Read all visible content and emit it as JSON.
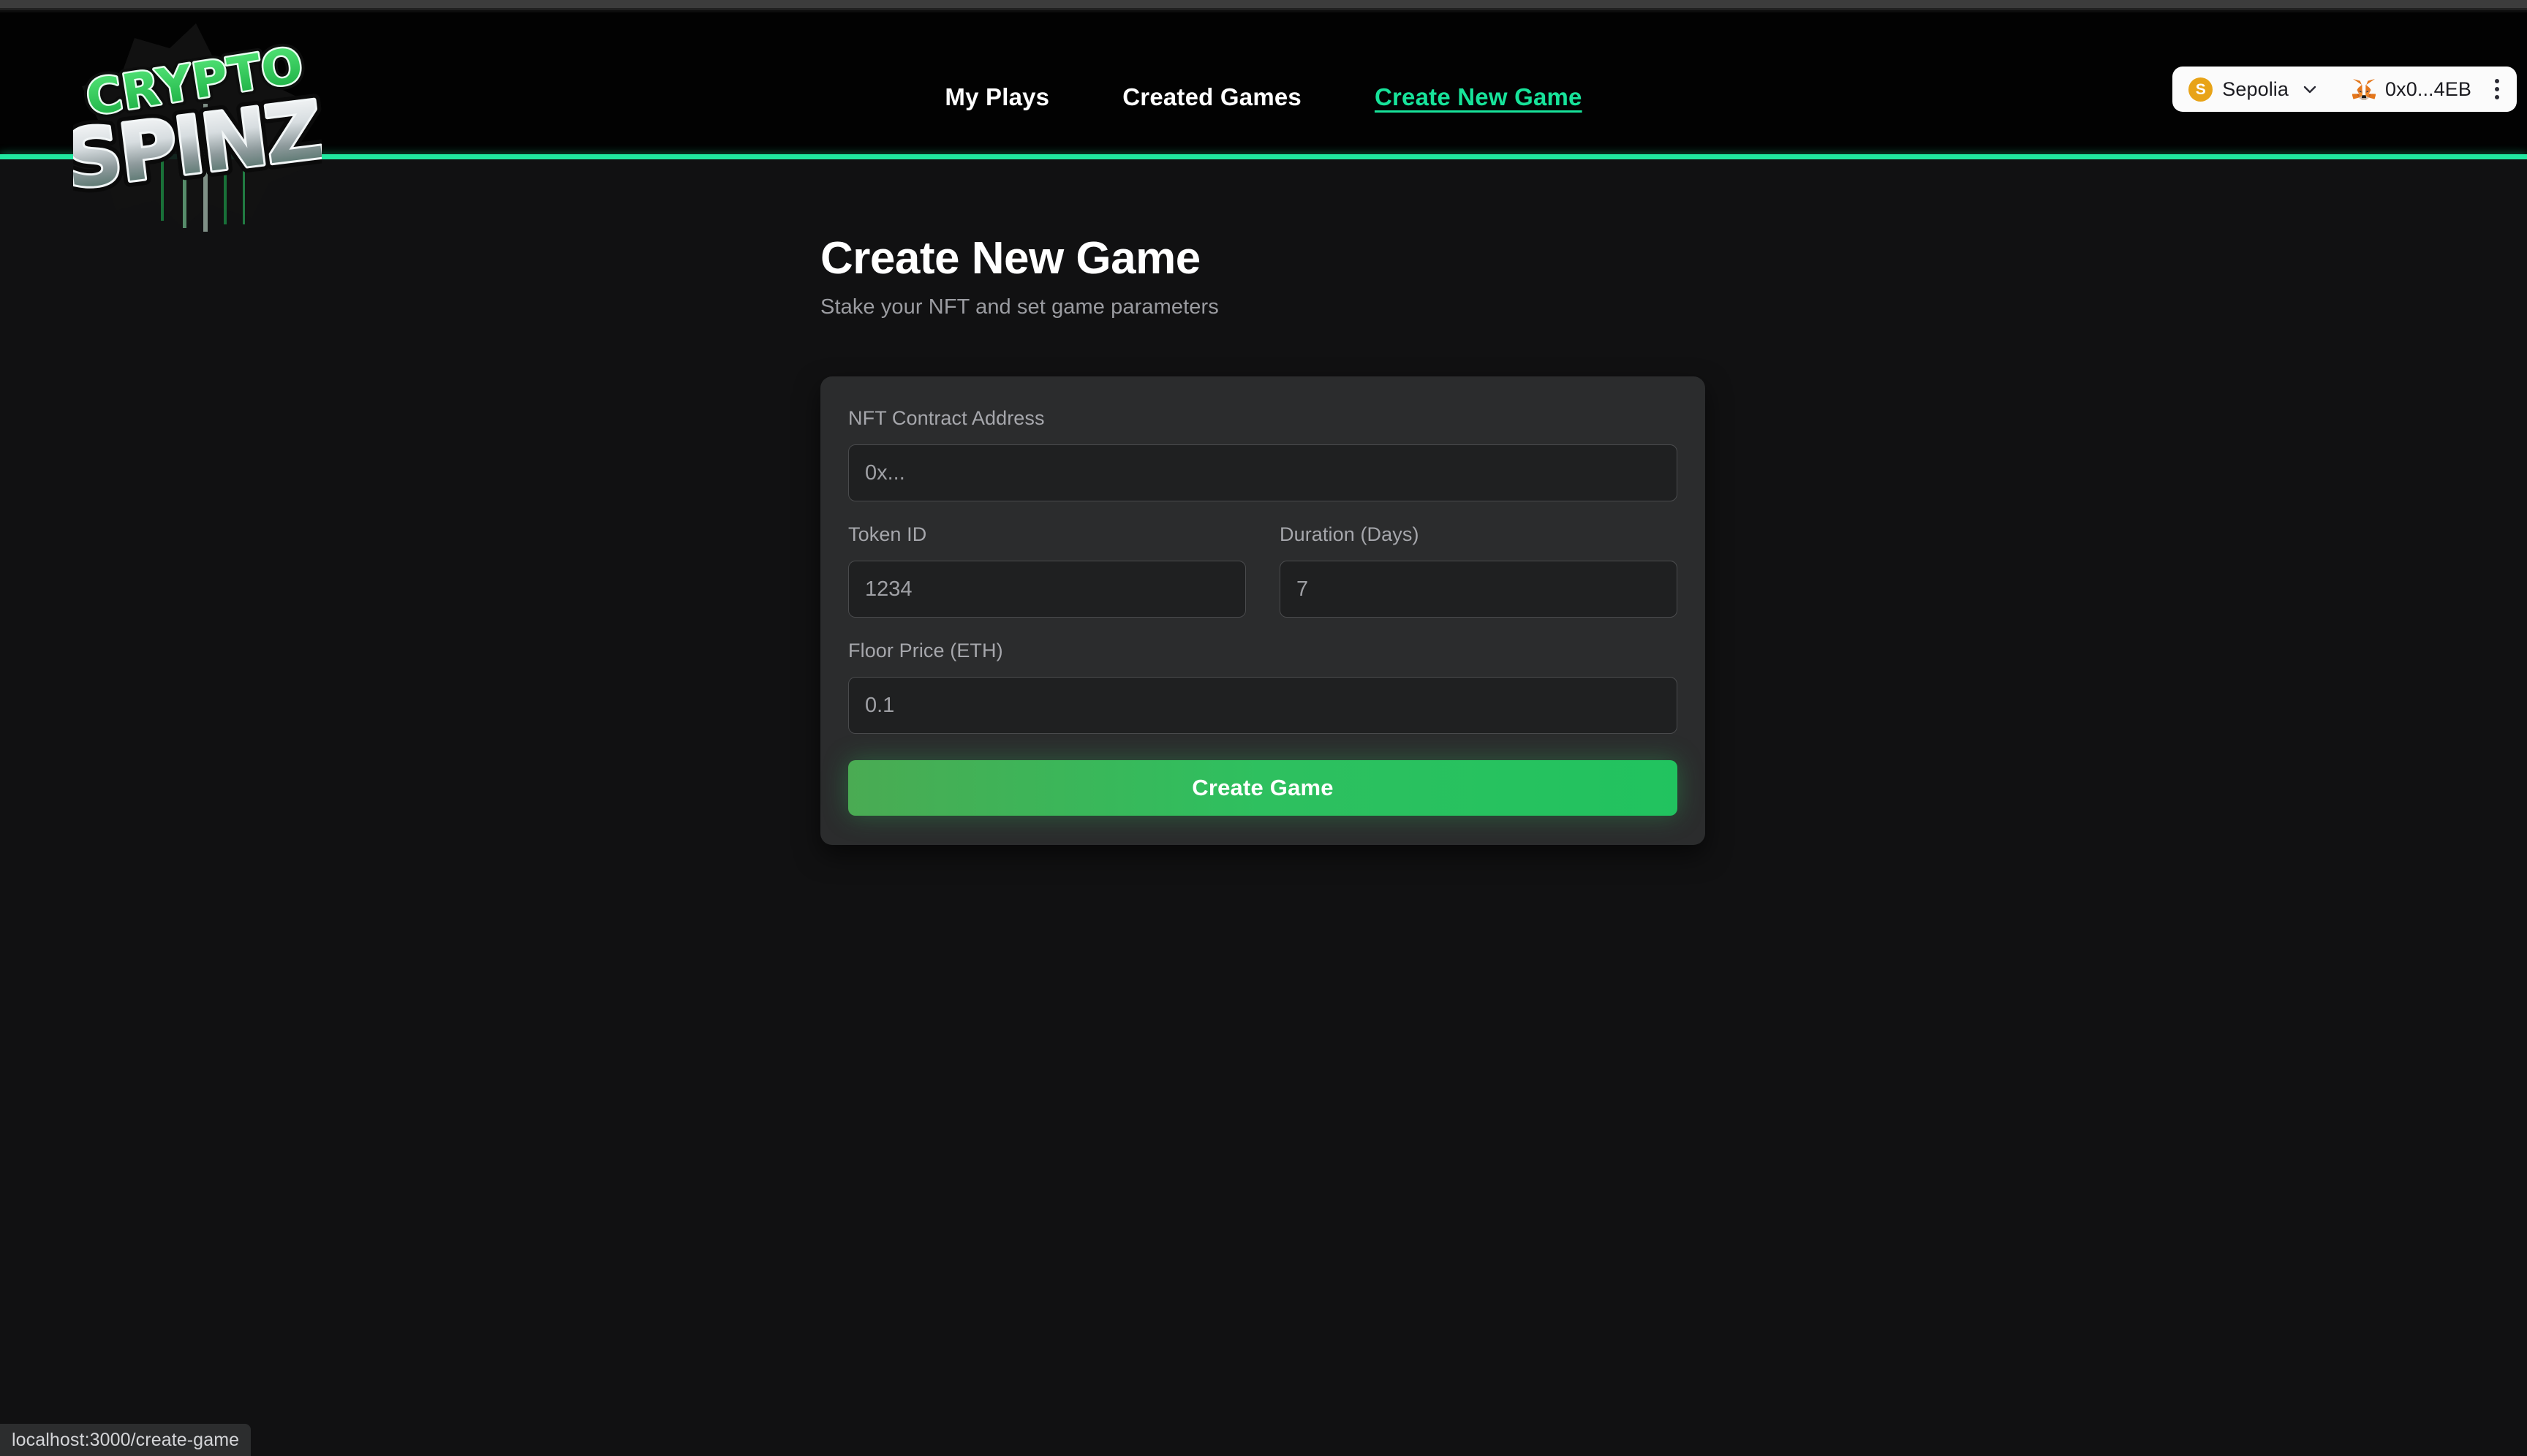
{
  "browser": {
    "status_url": "localhost:3000/create-game"
  },
  "header": {
    "logo": {
      "line1": "CRYPTO",
      "line2": "SPINZ",
      "accent_color": "#2ecc5a",
      "metal_color": "#e9eef0"
    },
    "nav": [
      {
        "label": "My Plays",
        "active": false
      },
      {
        "label": "Created Games",
        "active": false
      },
      {
        "label": "Create New Game",
        "active": true
      }
    ],
    "accent_rule_color": "#20e8a0",
    "wallet": {
      "chain_initial": "S",
      "chain_name": "Sepolia",
      "chain_badge_color": "#e8a317",
      "account": "0x0...4EB",
      "chevron_icon": "chevron-down-icon",
      "wallet_icon": "metamask-fox-icon",
      "menu_icon": "kebab-menu-icon"
    }
  },
  "main": {
    "title": "Create New Game",
    "subtitle": "Stake your NFT and set game parameters",
    "form": {
      "fields": [
        {
          "label": "NFT Contract Address",
          "placeholder": "0x...",
          "value": ""
        },
        {
          "label": "Token ID",
          "placeholder": "1234",
          "value": ""
        },
        {
          "label": "Duration (Days)",
          "placeholder": "7",
          "value": ""
        },
        {
          "label": "Floor Price (ETH)",
          "placeholder": "0.1",
          "value": ""
        }
      ],
      "submit_label": "Create Game",
      "submit_color": "#2ec05f"
    }
  }
}
